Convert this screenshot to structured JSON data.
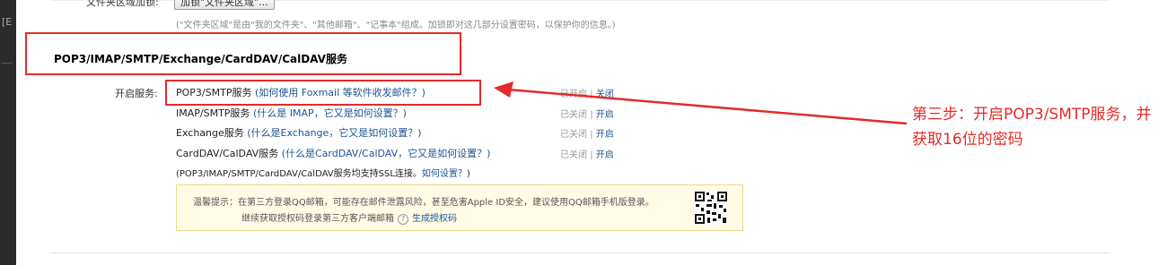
{
  "folder_area": {
    "label": "文件夹区域加锁:",
    "button_label": "加锁\"文件夹区域\"...",
    "note": "(\"文件夹区域\"是由\"我的文件夹\"、\"其他邮箱\"、\"记事本\"组成。加锁即对这几部分设置密码，以保护你的信息。)"
  },
  "section": {
    "title": "POP3/IMAP/SMTP/Exchange/CardDAV/CalDAV服务"
  },
  "services": {
    "label": "开启服务:",
    "items": [
      {
        "name": "POP3/SMTP服务",
        "help": "(如何使用 Foxmail 等软件收发邮件？)",
        "status": "已开启",
        "action": "关闭"
      },
      {
        "name": "IMAP/SMTP服务",
        "help": "(什么是 IMAP，它又是如何设置？)",
        "status": "已关闭",
        "action": "开启"
      },
      {
        "name": "Exchange服务",
        "help": "(什么是Exchange，它又是如何设置？)",
        "status": "已关闭",
        "action": "开启"
      },
      {
        "name": "CardDAV/CalDAV服务",
        "help": "(什么是CardDAV/CalDAV，它又是如何设置？)",
        "status": "已关闭",
        "action": "开启"
      }
    ],
    "ssl_note": "(POP3/IMAP/SMTP/CardDAV/CalDAV服务均支持SSL连接。",
    "ssl_link": "如何设置？",
    "ssl_close": ")"
  },
  "tip": {
    "line1": "温馨提示：在第三方登录QQ邮箱，可能存在邮件泄露风险，甚至危害Apple ID安全，建议使用QQ邮箱手机版登录。",
    "line2": "继续获取授权码登录第三方客户端邮箱",
    "help_icon": "?",
    "link": "生成授权码"
  },
  "annotation": {
    "text": "第三步：开启POP3/SMTP服务，并获取16位的密码",
    "color": "#e42a2a"
  },
  "left_strip": {
    "glyph": "[E"
  }
}
